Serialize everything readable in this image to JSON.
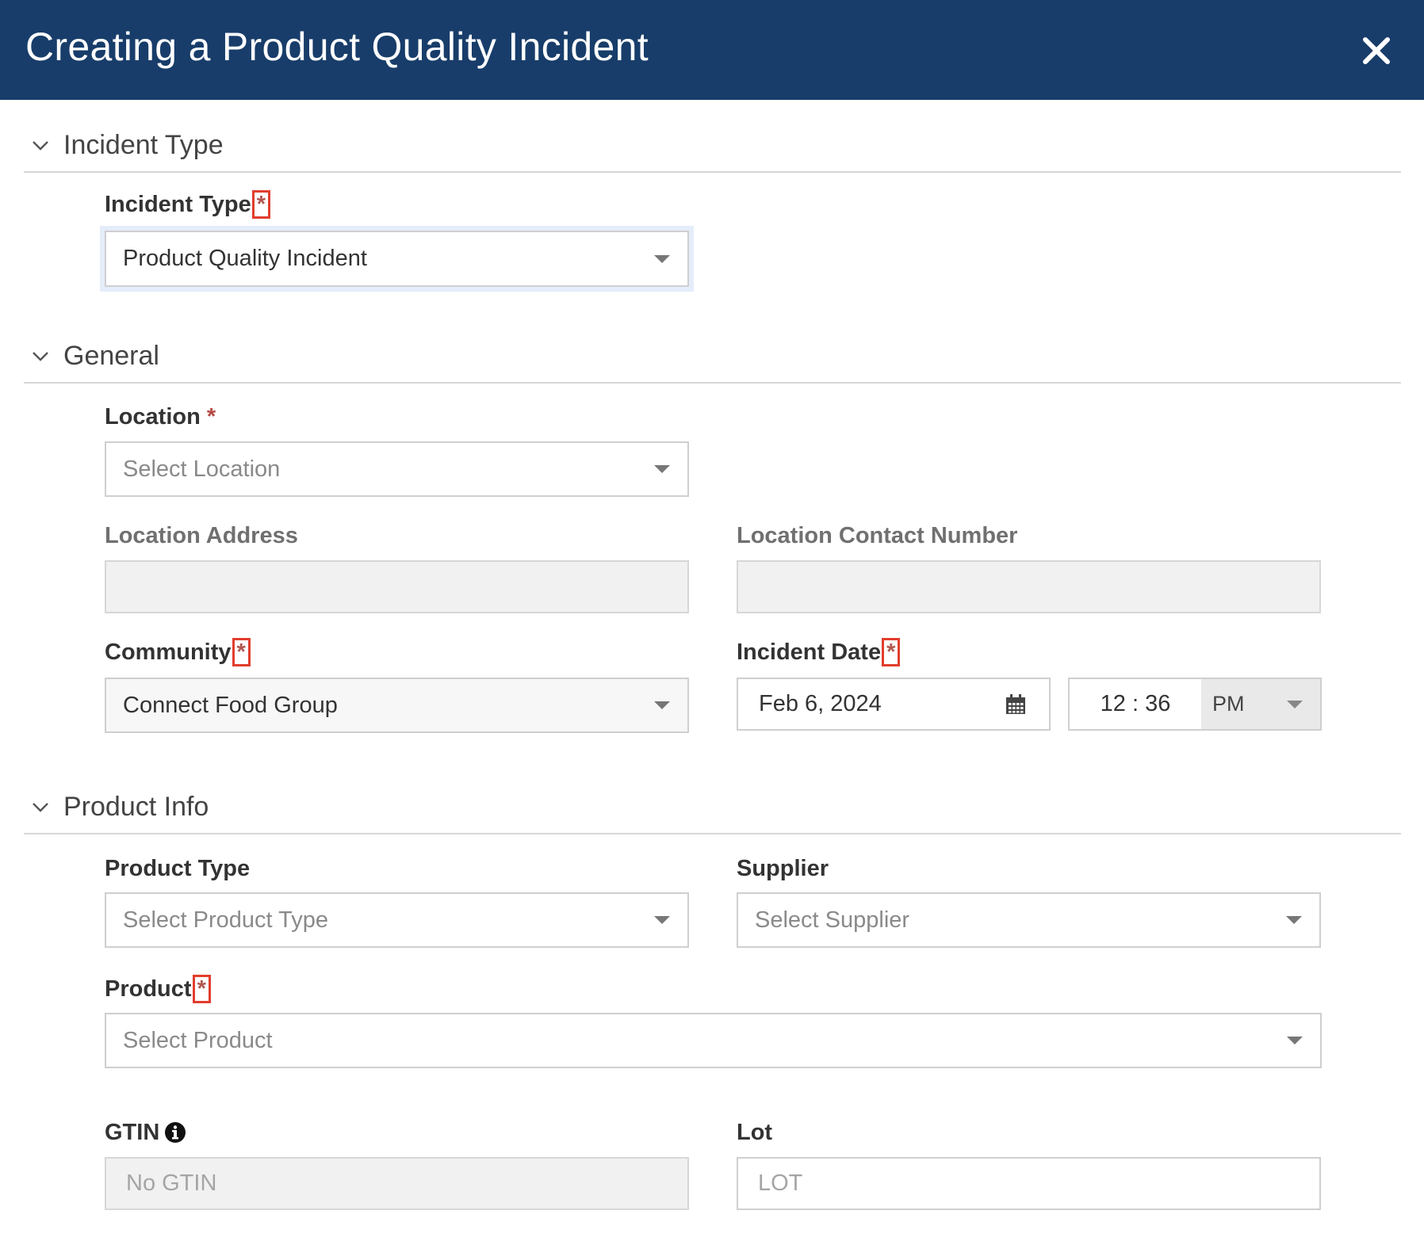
{
  "header": {
    "title": "Creating a Product Quality Incident",
    "close_icon": "close-icon"
  },
  "sections": {
    "incident_type": "Incident Type",
    "general": "General",
    "product_info": "Product Info"
  },
  "fields": {
    "incident_type": {
      "label": "Incident Type",
      "required": "*",
      "value": "Product Quality Incident"
    },
    "location": {
      "label": "Location",
      "required": "*",
      "placeholder": "Select Location"
    },
    "location_address": {
      "label": "Location Address",
      "value": ""
    },
    "location_contact": {
      "label": "Location Contact Number",
      "value": ""
    },
    "community": {
      "label": "Community",
      "required": "*",
      "value": "Connect Food Group"
    },
    "incident_date": {
      "label": "Incident Date",
      "required": "*",
      "date": "Feb 6, 2024",
      "time": "12 : 36",
      "ampm": "PM"
    },
    "product_type": {
      "label": "Product Type",
      "placeholder": "Select Product Type"
    },
    "supplier": {
      "label": "Supplier",
      "placeholder": "Select Supplier"
    },
    "product": {
      "label": "Product",
      "required": "*",
      "placeholder": "Select Product"
    },
    "gtin": {
      "label": "GTIN",
      "placeholder": "No GTIN"
    },
    "lot": {
      "label": "Lot",
      "placeholder": "LOT"
    }
  },
  "colors": {
    "header_bg": "#183d6a",
    "required": "#b44a43",
    "highlight_box": "#e23d2e"
  }
}
